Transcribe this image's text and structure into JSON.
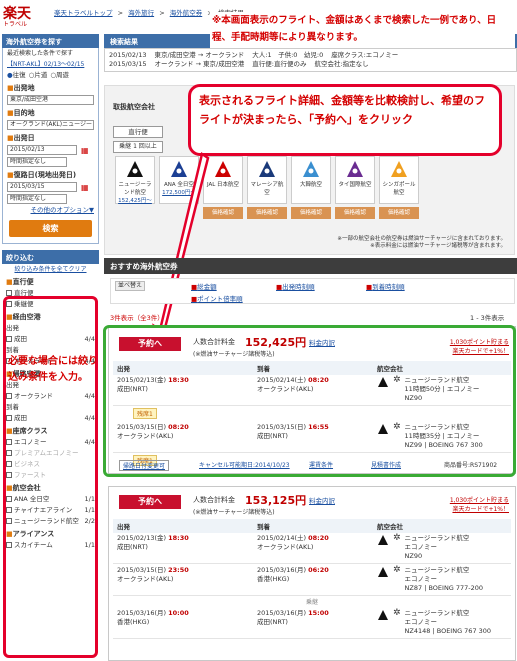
{
  "header": {
    "logo": "楽天",
    "logo_sub": "トラベル",
    "breadcrumb": [
      "楽天トラベルトップ",
      ">",
      "海外旅行",
      ">",
      "海外航空券",
      ">",
      "検索結果"
    ],
    "notice": "※本画面表示のフライト、金額はあくまで検索した一例であり、日程、手配時期等により異なります。"
  },
  "sidebar": {
    "search_title": "海外航空券を探す",
    "recent_label": "最近検索した条件で探す",
    "recent_value": "【NRT-AKL】02/13〜02/15",
    "trip_types": [
      "往復",
      "片道",
      "周遊"
    ],
    "origin_label": "出発地",
    "origin_value": "東京/成田空港",
    "dest_label": "目的地",
    "dest_value": "オークランド(AKL)ニュージー",
    "depart_label": "出発日",
    "depart_value": "2015/02/13",
    "depart_time": "時間指定なし",
    "return_label": "復路日(現地出発日)",
    "return_value": "2015/03/15",
    "return_time": "時間指定なし",
    "options_link": "その他のオプション▼",
    "search_button": "検索",
    "filter_title": "絞り込む",
    "filter_reset": "絞り込み条件を全てクリア",
    "filters": [
      {
        "title": "直行便",
        "items": [
          {
            "label": "直行便",
            "count": ""
          },
          {
            "label": "乗継便",
            "count": ""
          }
        ]
      },
      {
        "title": "経由空港",
        "items": [
          {
            "label": "出発",
            "count": ""
          },
          {
            "label": "成田",
            "count": "4/4"
          },
          {
            "label": "到着",
            "count": ""
          },
          {
            "label": "オークランド",
            "count": "4/4"
          }
        ]
      },
      {
        "title": "帰路空港",
        "items": [
          {
            "label": "出発",
            "count": ""
          },
          {
            "label": "オークランド",
            "count": "4/4"
          },
          {
            "label": "到着",
            "count": ""
          },
          {
            "label": "成田",
            "count": "4/4"
          }
        ]
      },
      {
        "title": "座席クラス",
        "items": [
          {
            "label": "エコノミー",
            "count": "4/4"
          },
          {
            "label": "プレミアムエコノミー",
            "count": ""
          },
          {
            "label": "ビジネス",
            "count": ""
          },
          {
            "label": "ファースト",
            "count": ""
          }
        ]
      },
      {
        "title": "航空会社",
        "items": [
          {
            "label": "ANA 全日空",
            "count": "1/1"
          },
          {
            "label": "チャイナエアライン",
            "count": "1/1"
          },
          {
            "label": "ニュージーランド航空",
            "count": "2/2"
          }
        ]
      },
      {
        "title": "アライアンス",
        "items": [
          {
            "label": "スカイチーム",
            "count": "1/1"
          }
        ]
      }
    ],
    "hint": "必要な場合には絞り込み条件を入力。"
  },
  "main": {
    "title": "検索結果",
    "route_rows": [
      {
        "date": "2015/02/13",
        "route": "東京/成田空港 → オークランド",
        "pax": "大人:1　子供:0　幼児:0",
        "class": "座席クラス:エコノミー"
      },
      {
        "date": "2015/03/15",
        "route": "オークランド → 東京/成田空港",
        "pax": "直行便:直行便のみ",
        "class": "航空会社:指定なし"
      }
    ],
    "airline_label": "取扱航空会社",
    "tabs": [
      "直行便",
      "乗継 1 回以上"
    ],
    "airlines": [
      {
        "name": "ニュージーランド航空",
        "price": "152,425円〜",
        "color": "#111111"
      },
      {
        "name": "ANA 全日空",
        "price": "172,500円〜",
        "color": "#1c3f94"
      },
      {
        "name": "JAL 日本航空",
        "price": "",
        "color": "#cc0000"
      },
      {
        "name": "マレーシア航空",
        "price": "",
        "color": "#1a3a7a"
      },
      {
        "name": "大韓航空",
        "price": "",
        "color": "#3a8fd0"
      },
      {
        "name": "タイ国際航空",
        "price": "",
        "color": "#6a2c91"
      },
      {
        "name": "シンガポール航空",
        "price": "",
        "color": "#f0a020"
      }
    ],
    "price_check": "価格確認",
    "fee_note": "※一部の航空会社の航空券は燃油サーチャージに含まれております。",
    "fee_note2": "※表示料金には燃油サーチャージ諸税等が含まれます。",
    "balloon": "表示されるフライト詳細、金額等を比較検討し、希望のフライトが決まったら、「予約へ」をクリック",
    "osusume": "おすすめ海外航空券",
    "sort_label": "並べ替え",
    "sort_options": [
      "総金額",
      "出発時刻順",
      "到着時刻順",
      "ポイント倍率順"
    ],
    "count_text": "3件表示（全3件）",
    "pager": "1 - 3件表示",
    "results": [
      {
        "button": "予約へ",
        "total_label": "人数合計料金",
        "price": "152,425円",
        "detail": "料金内訳",
        "tax_note": "(※燃油サーチャージ諸税等込)",
        "points": "1,030ポイント貯まる",
        "card": "楽天カードで+1%！",
        "segments": [
          {
            "d_date": "2015/02/13(金)",
            "d_time": "18:30",
            "d_place": "成田(NRT)",
            "a_date": "2015/02/14(土)",
            "a_time": "08:20",
            "a_place": "オークランド(AKL)",
            "airline": "ニュージーランド航空",
            "info": "11時間50分 | エコノミー",
            "flight": "NZ90",
            "tag": "残席1"
          },
          {
            "d_date": "2015/03/15(日)",
            "d_time": "08:20",
            "d_place": "オークランド(AKL)",
            "a_date": "2015/03/15(日)",
            "a_time": "16:55",
            "a_place": "成田(NRT)",
            "airline": "ニュージーランド航空",
            "info": "11時間35分 | エコノミー",
            "flight": "NZ99 | BOEING 767 300",
            "tag": "残席1"
          }
        ],
        "footer": [
          "帰路日付変更可",
          "キャンセル可能期日:2014/10/23",
          "運賃条件",
          "見積書作成"
        ],
        "product_no": "商品番号:RS71902"
      },
      {
        "button": "予約へ",
        "total_label": "人数合計料金",
        "price": "153,125円",
        "detail": "料金内訳",
        "tax_note": "(※燃油サーチャージ諸税等込)",
        "points": "1,030ポイント貯まる",
        "card": "楽天カードで+1%！",
        "segments": [
          {
            "d_date": "2015/02/13(金)",
            "d_time": "18:30",
            "d_place": "成田(NRT)",
            "a_date": "2015/02/14(土)",
            "a_time": "08:20",
            "a_place": "オークランド(AKL)",
            "airline": "ニュージーランド航空",
            "info": "エコノミー",
            "flight": "NZ90",
            "tag": ""
          },
          {
            "d_date": "2015/03/15(日)",
            "d_time": "23:50",
            "d_place": "オークランド(AKL)",
            "a_date": "2015/03/16(月)",
            "a_time": "06:20",
            "a_place": "香港(HKG)",
            "airline": "ニュージーランド航空",
            "info": "エコノミー",
            "flight": "NZ87 | BOEING 777-200",
            "tag": ""
          },
          {
            "d_date": "2015/03/16(月)",
            "d_time": "10:00",
            "d_place": "香港(HKG)",
            "a_date": "2015/03/16(月)",
            "a_time": "15:00",
            "a_place": "成田(NRT)",
            "airline": "ニュージーランド航空",
            "info": "エコノミー",
            "flight": "NZ4148 | BOEING 767 300",
            "tag": ""
          }
        ],
        "transfer": "乗継",
        "footer": [],
        "product_no": ""
      }
    ],
    "col_headers": [
      "出発",
      "到着",
      "航空会社"
    ]
  }
}
